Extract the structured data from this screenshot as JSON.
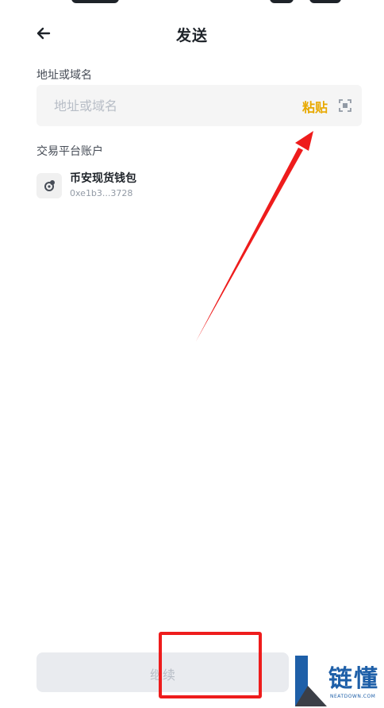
{
  "header": {
    "title": "发送",
    "back_icon": "arrow-left-icon"
  },
  "address": {
    "label": "地址或域名",
    "placeholder": "地址或域名",
    "value": "",
    "paste_label": "粘贴",
    "scan_icon": "scan-icon"
  },
  "accounts": {
    "label": "交易平台账户",
    "items": [
      {
        "name": "币安现货钱包",
        "address": "0xe1b3...3728",
        "icon": "wallet-icon"
      }
    ]
  },
  "footer": {
    "continue_label": "继续"
  },
  "watermark": {
    "brand": "链懂",
    "domain": "NEATDOWN.COM"
  },
  "colors": {
    "accent": "#e8a900",
    "annotation_red": "#ee1c1c",
    "watermark_blue": "#1e5fa8",
    "button_disabled_bg": "#e9ebef"
  }
}
